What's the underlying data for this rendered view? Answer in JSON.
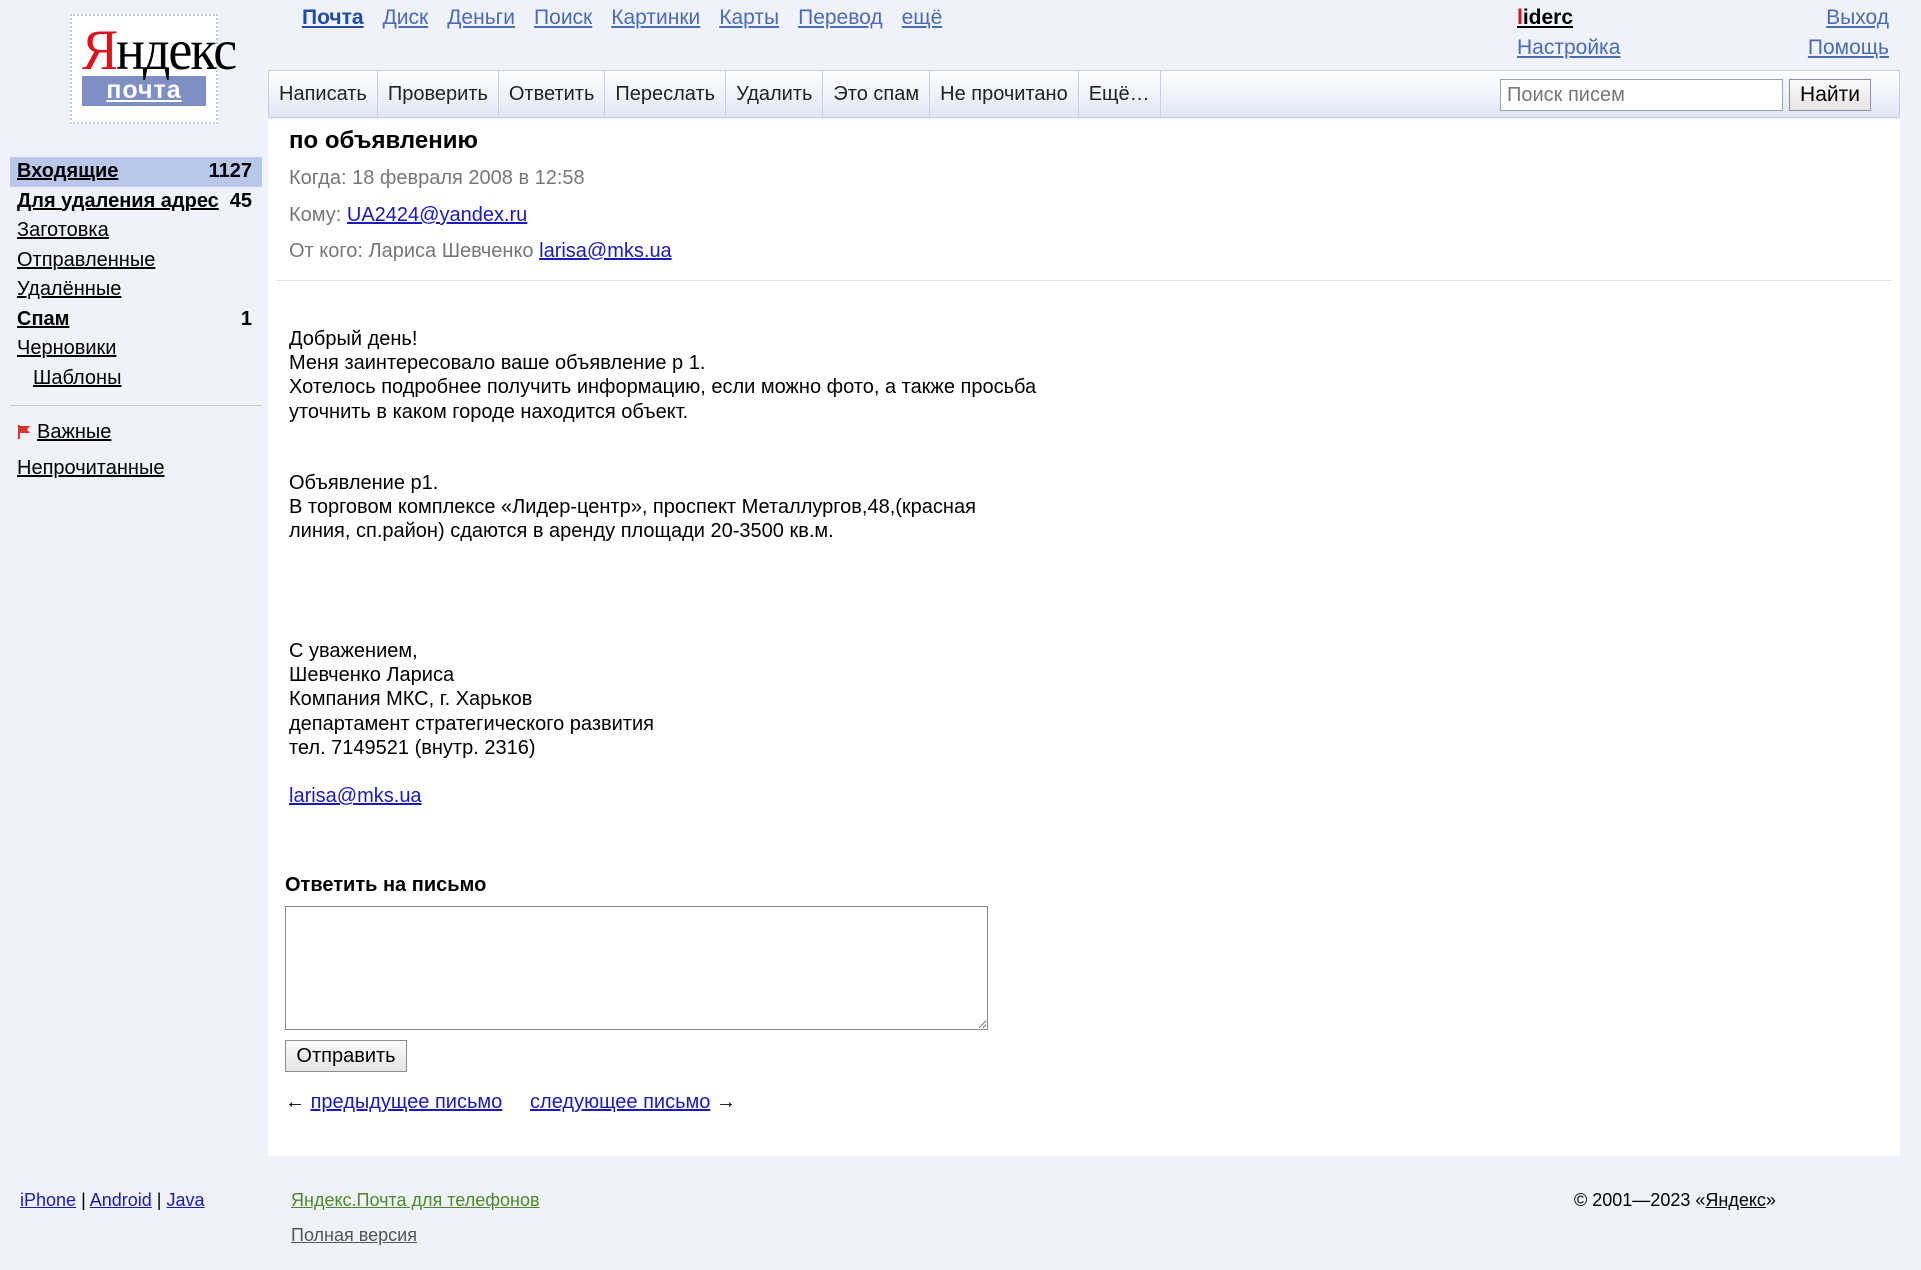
{
  "logo": {
    "main": "Яндекс",
    "sub": "почта"
  },
  "services": [
    "Почта",
    "Диск",
    "Деньги",
    "Поиск",
    "Картинки",
    "Карты",
    "Перевод",
    "ещё"
  ],
  "user": {
    "login": "liderc",
    "settings": "Настройка"
  },
  "topright": {
    "logout": "Выход",
    "help": "Помощь"
  },
  "toolbar": {
    "buttons": [
      "Написать",
      "Проверить",
      "Ответить",
      "Переслать",
      "Удалить",
      "Это спам",
      "Не прочитано",
      "Ещё…"
    ],
    "search_placeholder": "Поиск писем",
    "search_button": "Найти"
  },
  "sidebar": {
    "folders": [
      {
        "label": "Входящие",
        "count": "1127",
        "bold": true,
        "active": true
      },
      {
        "label": "Для удаления адрес",
        "count": "45",
        "bold": true
      },
      {
        "label": "Заготовка",
        "count": ""
      },
      {
        "label": "Отправленные",
        "count": ""
      },
      {
        "label": "Удалённые",
        "count": ""
      },
      {
        "label": "Спам",
        "count": "1",
        "bold": true
      },
      {
        "label": "Черновики",
        "count": ""
      },
      {
        "label": "Шаблоны",
        "count": "",
        "sub": true
      }
    ],
    "important": "Важные",
    "unread": "Непрочитанные"
  },
  "message": {
    "subject": "по объявлению",
    "when_label": "Когда:",
    "when": "18 февраля 2008 в 12:58",
    "to_label": "Кому:",
    "to": "UA2424@yandex.ru",
    "from_label": "От кого:",
    "from_name": "Лариса Шевченко",
    "from_email": "larisa@mks.ua",
    "body_p1": "Добрый день!\nМеня заинтересовало ваше объявление р 1.\nХотелось подробнее получить информацию, если можно фото, а также просьба\nуточнить в каком городе находится объект.",
    "body_p2": "Объявление р1.\nВ торговом комплексе «Лидер-центр», проспект Металлургов,48,(красная\nлиния, сп.район) сдаются в аренду площади 20-3500 кв.м.",
    "body_p3": "С уважением,\nШевченко Лариса\nКомпания МКС, г. Харьков\nдепартамент стратегического развития\nтел. 7149521 (внутр. 2316)",
    "signature_email": "larisa@mks.ua"
  },
  "reply": {
    "title": "Ответить на письмо",
    "send": "Отправить"
  },
  "nav": {
    "prev": "предыдущее письмо",
    "next": "следующее письмо",
    "left_arrow": "←",
    "right_arrow": "→"
  },
  "footer": {
    "apps": [
      "iPhone",
      "Android",
      "Java"
    ],
    "phones": "Яндекс.Почта для телефонов",
    "full": "Полная версия",
    "copyright_prefix": "© 2001—2023 «",
    "copyright_link": "Яндекс",
    "copyright_suffix": "»"
  }
}
